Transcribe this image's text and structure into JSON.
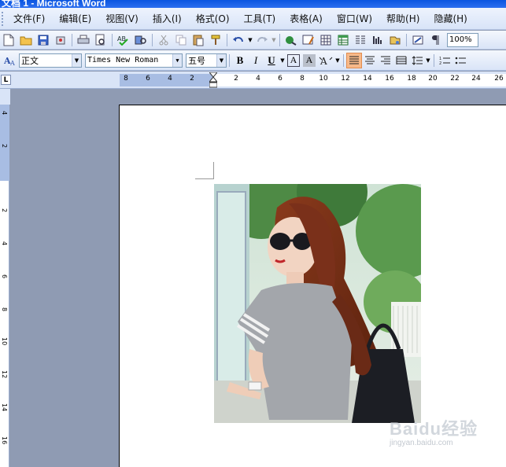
{
  "window": {
    "title": "文档 1 - Microsoft Word"
  },
  "menu": [
    {
      "id": "file",
      "label": "文件(F)"
    },
    {
      "id": "edit",
      "label": "编辑(E)"
    },
    {
      "id": "view",
      "label": "视图(V)"
    },
    {
      "id": "insert",
      "label": "插入(I)"
    },
    {
      "id": "format",
      "label": "格式(O)"
    },
    {
      "id": "tools",
      "label": "工具(T)"
    },
    {
      "id": "table",
      "label": "表格(A)"
    },
    {
      "id": "window",
      "label": "窗口(W)"
    },
    {
      "id": "help",
      "label": "帮助(H)"
    },
    {
      "id": "hide",
      "label": "隐藏(H)"
    }
  ],
  "toolbar": {
    "zoom": "100%",
    "icons": [
      "new-document-icon",
      "open-folder-icon",
      "save-icon",
      "permission-icon",
      "print-icon",
      "print-preview-icon",
      "spelling-icon",
      "research-icon",
      "cut-icon",
      "copy-icon",
      "paste-icon",
      "format-painter-icon",
      "undo-icon",
      "redo-icon",
      "hyperlink-icon",
      "drawing-tables-icon",
      "insert-table-icon",
      "insert-excel-icon",
      "columns-icon",
      "drawing-icon",
      "document-map-icon",
      "show-hide-icon"
    ]
  },
  "formatting": {
    "style": "正文",
    "font": "Times New Roman",
    "size": "五号",
    "bold": "B",
    "italic": "I",
    "underline": "U",
    "char_border": "A",
    "char_shade": "A",
    "active_align": "justify"
  },
  "ruler": {
    "left_numbers": [
      "8",
      "6",
      "4",
      "2"
    ],
    "right_numbers": [
      "2",
      "4",
      "6",
      "8",
      "10",
      "12",
      "14",
      "16",
      "18",
      "20",
      "22",
      "24",
      "26"
    ],
    "vertical_numbers": [
      "4",
      "2",
      "2",
      "4",
      "6",
      "8",
      "10",
      "12",
      "14",
      "16"
    ],
    "corner": "L"
  },
  "watermark": {
    "main": "Baidu经验",
    "sub": "jingyan.baidu.com"
  },
  "colors": {
    "menubar": "#d8e4f8",
    "page": "#ffffff",
    "workspace": "#8f9bb3",
    "active_button": "#f7b989"
  }
}
